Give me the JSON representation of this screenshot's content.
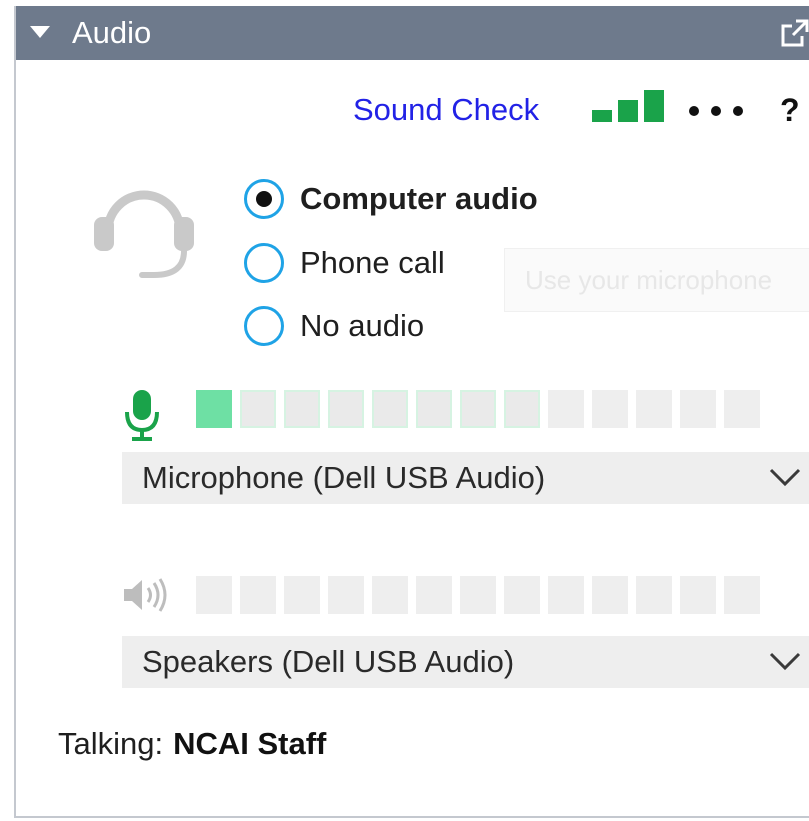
{
  "header": {
    "title": "Audio",
    "collapse_icon": "caret-down-icon",
    "popout_icon": "popout-icon"
  },
  "toolbar": {
    "sound_check_label": "Sound Check",
    "signal_icon": "signal-strength-icon",
    "more_icon": "more-options-icon",
    "help_label": "?"
  },
  "audio_mode": {
    "icon": "headset-icon",
    "options": [
      {
        "label": "Computer audio",
        "selected": true
      },
      {
        "label": "Phone call",
        "selected": false
      },
      {
        "label": "No audio",
        "selected": false
      }
    ],
    "tooltip_text": "Use your microphone"
  },
  "microphone": {
    "icon": "microphone-icon",
    "level_segments": 13,
    "level_lit": 1,
    "level_highlighted": 7,
    "device": "Microphone (Dell USB Audio)"
  },
  "speaker": {
    "icon": "speaker-icon",
    "level_segments": 13,
    "level_lit": 0,
    "device": "Speakers (Dell USB Audio)"
  },
  "talking": {
    "label": "Talking:",
    "name": "NCAI Staff"
  },
  "colors": {
    "header_bg": "#6e7a8c",
    "link": "#2222e6",
    "radio_ring": "#1fa3e6",
    "signal_green": "#1aa34a",
    "mic_green": "#1aa34a",
    "meter_lit": "#6ee0a4",
    "meter_off": "#eeeeee"
  }
}
